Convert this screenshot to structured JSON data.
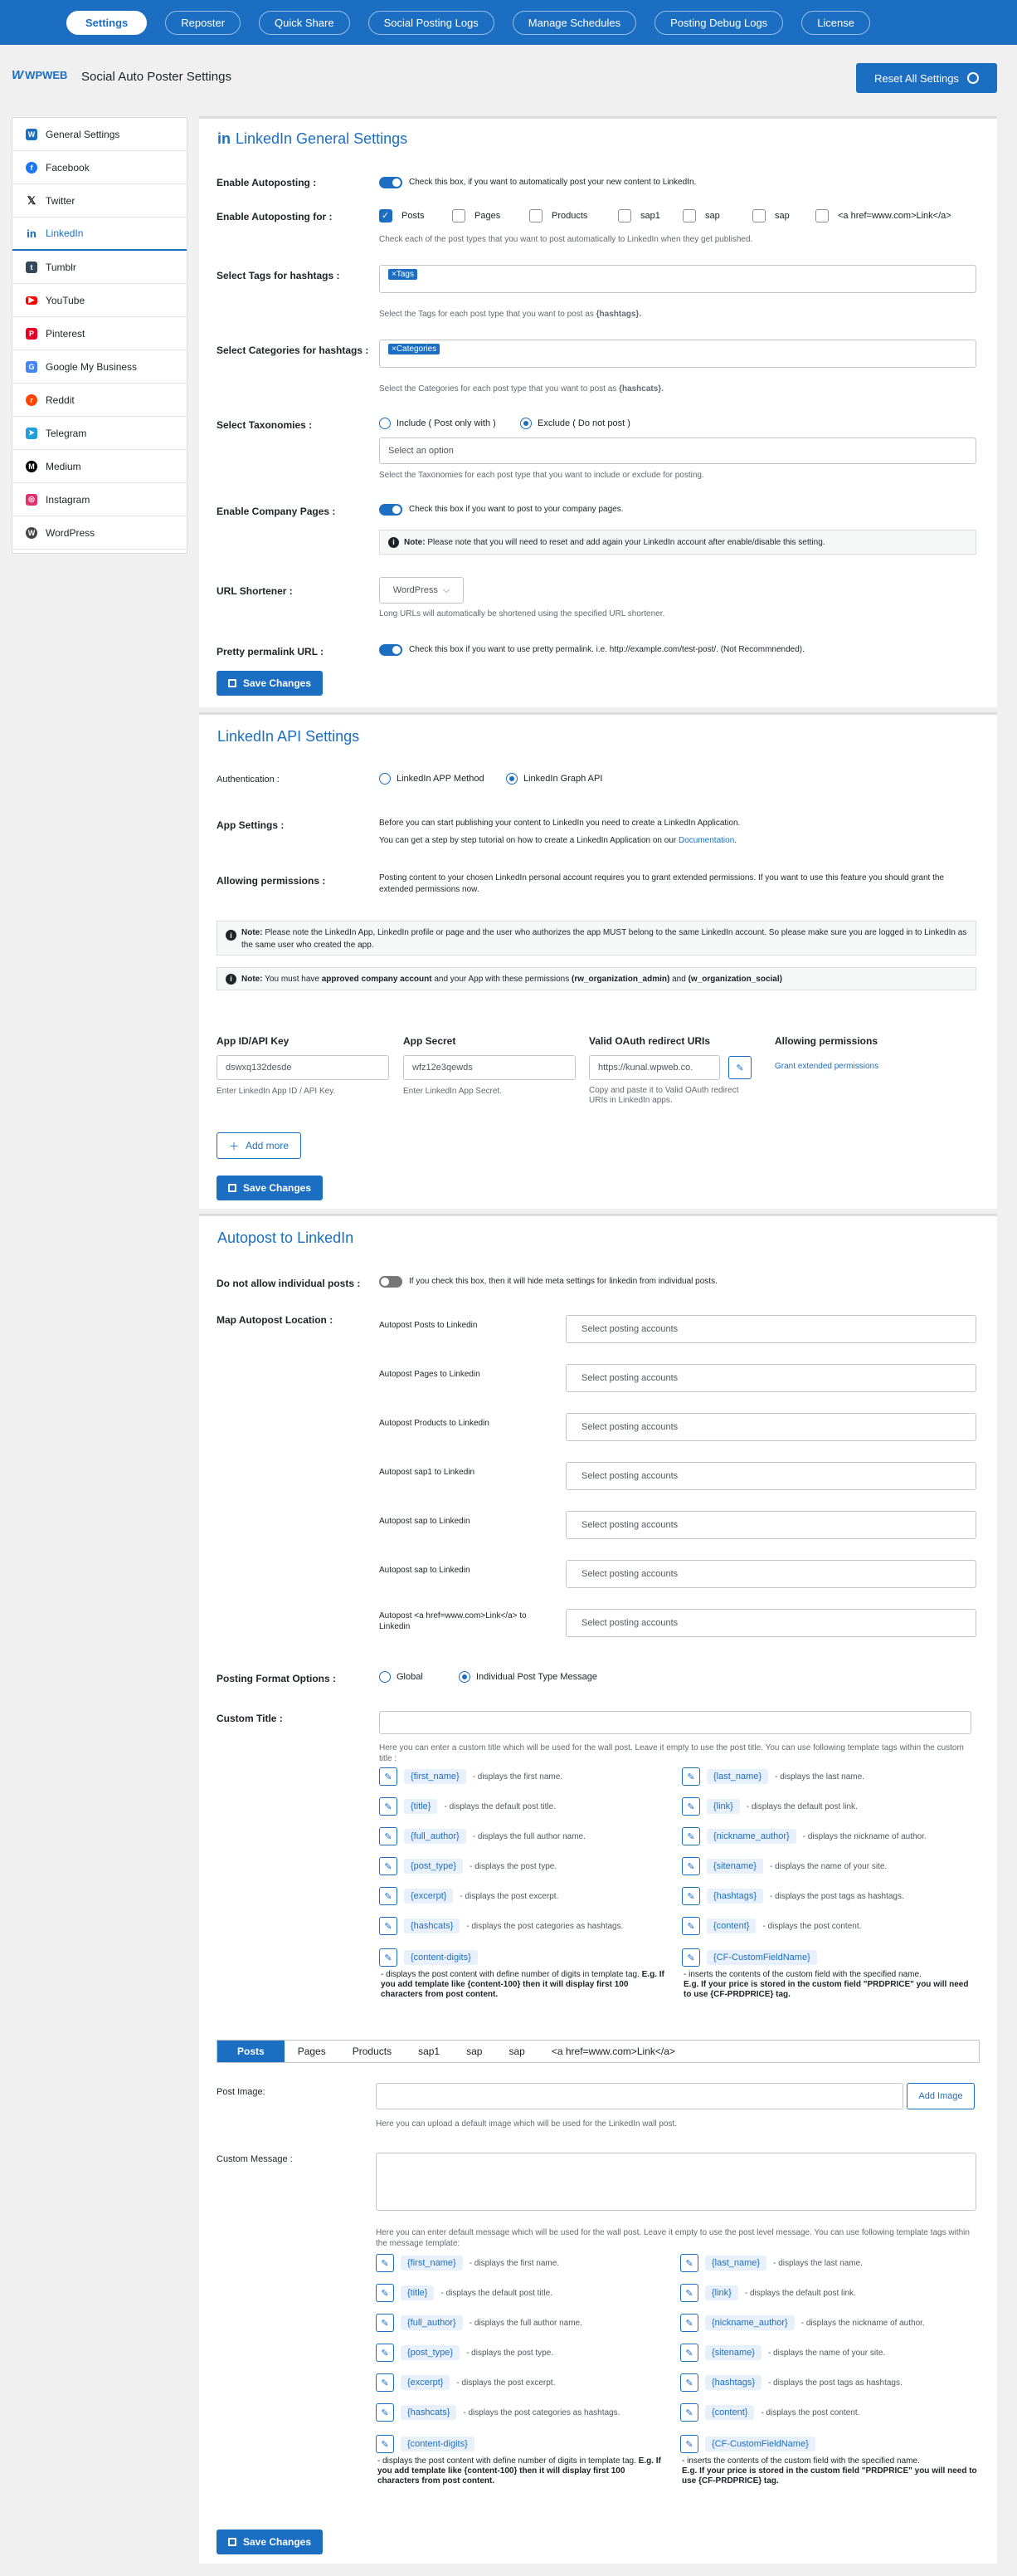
{
  "nav": [
    "Settings",
    "Reposter",
    "Quick Share",
    "Social Posting Logs",
    "Manage Schedules",
    "Posting Debug Logs",
    "License"
  ],
  "header": {
    "logo": "WPWEB",
    "title": "Social Auto Poster Settings",
    "reset": "Reset All Settings"
  },
  "sidebar": [
    {
      "label": "General Settings",
      "icon": "wpweb-icon",
      "color": "#1b6ec2"
    },
    {
      "label": "Facebook",
      "icon": "facebook-icon",
      "color": "#1877f2"
    },
    {
      "label": "Twitter",
      "icon": "x-icon",
      "color": "#111111"
    },
    {
      "label": "LinkedIn",
      "icon": "linkedin-icon",
      "color": "#0a66c2"
    },
    {
      "label": "Tumblr",
      "icon": "tumblr-icon",
      "color": "#36465d"
    },
    {
      "label": "YouTube",
      "icon": "youtube-icon",
      "color": "#ff0000"
    },
    {
      "label": "Pinterest",
      "icon": "pinterest-icon",
      "color": "#e60023"
    },
    {
      "label": "Google My Business",
      "icon": "google-icon",
      "color": "#4285f4"
    },
    {
      "label": "Reddit",
      "icon": "reddit-icon",
      "color": "#ff4500"
    },
    {
      "label": "Telegram",
      "icon": "telegram-icon",
      "color": "#229ed9"
    },
    {
      "label": "Medium",
      "icon": "medium-icon",
      "color": "#000000"
    },
    {
      "label": "Instagram",
      "icon": "instagram-icon",
      "color": "#e1306c"
    },
    {
      "label": "WordPress",
      "icon": "wordpress-icon",
      "color": "#464646"
    }
  ],
  "general": {
    "title": "LinkedIn General Settings",
    "enable_autoposting": "Enable Autoposting :",
    "enable_autoposting_desc": "Check this box, if you want to automatically post your new content to LinkedIn.",
    "enable_for": "Enable Autoposting for :",
    "post_types": [
      "Posts",
      "Pages",
      "Products",
      "sap1",
      "sap",
      "sap",
      "<a href=www.com>Link</a>"
    ],
    "enable_for_help": "Check each of the post types that you want to post automatically to LinkedIn when they get published.",
    "tags_label": "Select Tags for hashtags :",
    "tags_chip": "×Tags",
    "tags_help_a": "Select the Tags for each post type that you want to post as ",
    "tags_help_b": "{hashtags}.",
    "cats_label": "Select Categories for hashtags :",
    "cats_chip": "×Categories",
    "cats_help_a": "Select the Categories for each post type that you want to post as ",
    "cats_help_b": "{hashcats}.",
    "tax_label": "Select Taxonomies :",
    "tax_include": "Include ( Post only with )",
    "tax_exclude": "Exclude ( Do not post )",
    "tax_placeholder": "Select an option",
    "tax_help": "Select the Taxonomies for each post type that you want to include or exclude for posting.",
    "company_label": "Enable Company Pages :",
    "company_desc": "Check this box if you want to post to your company pages.",
    "company_note_b": "Note:",
    "company_note": " Please note that you will need to reset and add again your LinkedIn account after enable/disable this setting.",
    "shortener_label": "URL Shortener :",
    "shortener_value": "WordPress",
    "shortener_help": "Long URLs will automatically be shortened using the specified URL shortener.",
    "permalink_label": "Pretty permalink URL :",
    "permalink_desc": "Check this box if you want to use pretty permalink. i.e. http://example.com/test-post/. (Not Recommnended).",
    "save": "Save Changes"
  },
  "api": {
    "title": "LinkedIn API Settings",
    "auth_label": "Authentication :",
    "auth_app": "LinkedIn APP Method",
    "auth_graph": "LinkedIn Graph API",
    "app_settings_label": "App Settings :",
    "app_settings_1": "Before you can start publishing your content to LinkedIn you need to create a LinkedIn Application.",
    "app_settings_2": "You can get a step by step tutorial on how to create a LinkedIn Application on our ",
    "app_settings_link": "Documentation",
    "app_settings_end": ".",
    "perm_label": "Allowing permissions :",
    "perm_text": "Posting content to your chosen LinkedIn personal account requires you to grant extended permissions. If you want to use this feature you should grant the extended permissions now.",
    "note1_b": "Note:",
    "note1": " Please note the LinkedIn App, LinkedIn profile or page and the user who authorizes the app MUST belong to the same LinkedIn account. So please make sure you are logged in to LinkedIn as the same user who created the app.",
    "note2_b": "Note:",
    "note2_a": " You must have ",
    "note2_bold1": "approved company account",
    "note2_c": " and your App with these permissions ",
    "note2_bold2": "(rw_organization_admin)",
    "note2_d": " and ",
    "note2_bold3": "(w_organization_social)",
    "col_app_id": "App ID/API Key",
    "col_secret": "App Secret",
    "col_oauth": "Valid OAuth redirect URIs",
    "col_perm": "Allowing permissions",
    "app_id_value": "dswxq132desde",
    "app_id_help": "Enter LinkedIn App ID / API Key.",
    "secret_value": "wfz12e3qewds",
    "secret_help": "Enter LinkedIn App Secret.",
    "oauth_value": "https://kunal.wpweb.co.",
    "oauth_help": "Copy and paste it to Valid OAuth redirect URIs in LinkedIn apps.",
    "grant_link": "Grant extended permissions",
    "add_more": "Add more",
    "save": "Save Changes"
  },
  "autopost": {
    "title": "Autopost to LinkedIn",
    "individual_label": "Do not allow individual posts :",
    "individual_desc": "If you check this box, then it will hide meta settings for linkedin from individual posts.",
    "map_label": "Map Autopost Location :",
    "locations": [
      "Autopost Posts to Linkedin",
      "Autopost Pages to Linkedin",
      "Autopost Products to Linkedin",
      "Autopost sap1 to Linkedin",
      "Autopost sap to Linkedin",
      "Autopost sap to Linkedin",
      "Autopost <a href=www.com>Link</a> to Linkedin"
    ],
    "select_placeholder": "Select posting accounts",
    "format_label": "Posting Format Options :",
    "format_global": "Global",
    "format_individual": "Individual Post Type Message",
    "custom_title_label": "Custom Title :",
    "custom_title_help": "Here you can enter a custom title which will be used for the wall post. Leave it empty to use the post title. You can use following template tags within the custom title :",
    "template_tags_left": [
      {
        "tag": "{first_name}",
        "desc": "- displays the first name."
      },
      {
        "tag": "{title}",
        "desc": "- displays the default post title."
      },
      {
        "tag": "{full_author}",
        "desc": "- displays the full author name."
      },
      {
        "tag": "{post_type}",
        "desc": "- displays the post type."
      },
      {
        "tag": "{excerpt}",
        "desc": "- displays the post excerpt."
      },
      {
        "tag": "{hashcats}",
        "desc": "- displays the post categories as hashtags."
      }
    ],
    "template_tags_right": [
      {
        "tag": "{last_name}",
        "desc": "- displays the last name."
      },
      {
        "tag": "{link}",
        "desc": "- displays the default post link."
      },
      {
        "tag": "{nickname_author}",
        "desc": "- displays the nickname of author."
      },
      {
        "tag": "{sitename}",
        "desc": "- displays the name of your site."
      },
      {
        "tag": "{hashtags}",
        "desc": "- displays the post tags as hashtags."
      },
      {
        "tag": "{content}",
        "desc": "- displays the post content."
      }
    ],
    "digits_tag": "{content-digits}",
    "digits_desc": "- displays the post content with define number of digits in template tag. ",
    "digits_desc_bold": "E.g. If you add template like {content-100} then it will display first 100 characters from post content.",
    "cf_tag": "{CF-CustomFieldName}",
    "cf_desc": "- inserts the contents of the custom field with the specified name.",
    "cf_desc_bold": "E.g. If your price is stored in the custom field \"PRDPRICE\" you will need to use {CF-PRDPRICE} tag.",
    "tabs": [
      "Posts",
      "Pages",
      "Products",
      "sap1",
      "sap",
      "sap",
      "<a href=www.com>Link</a>"
    ],
    "post_image_label": "Post Image:",
    "add_image": "Add Image",
    "post_image_help": "Here you can upload a default image which will be used for the LinkedIn wall post.",
    "custom_msg_label": "Custom Message :",
    "custom_msg_help": "Here you can enter default message which will be used for the wall post. Leave it empty to use the post level message. You can use following template tags within the message template:",
    "save": "Save Changes"
  }
}
